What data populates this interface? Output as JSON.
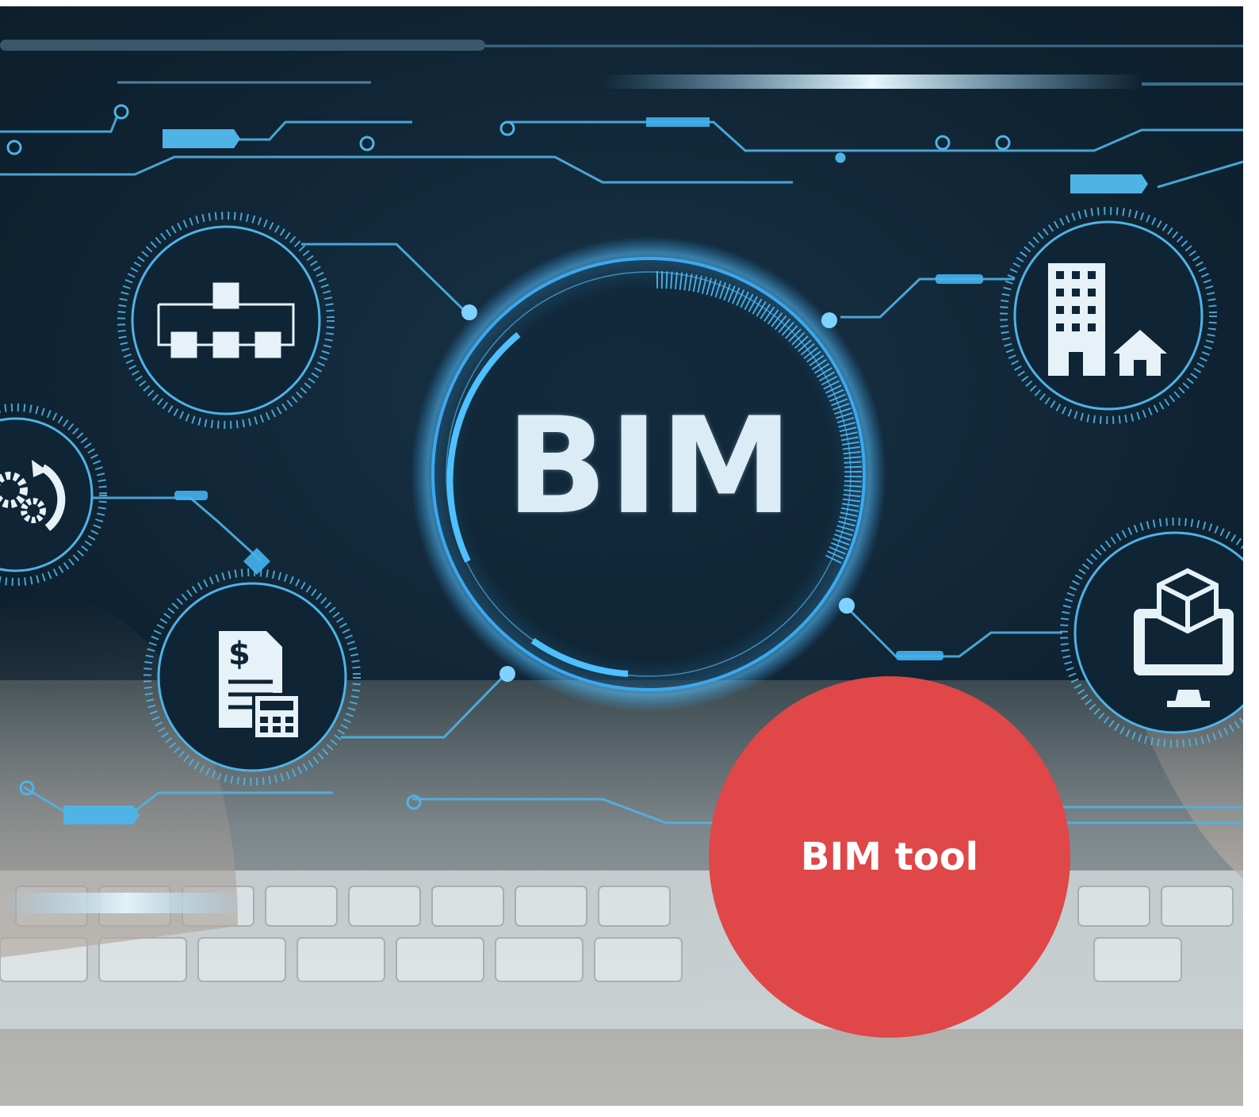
{
  "hero": {
    "center_label": "BIM",
    "icons": [
      "workflow-diagram-icon",
      "buildings-house-icon",
      "gears-cycle-icon",
      "cost-invoice-calculator-icon",
      "3d-model-monitor-icon"
    ],
    "colors": {
      "glow": "#3aa8f0",
      "line": "#4fb3e6",
      "icon_fill": "#e6f1f8",
      "background": "#0f2231"
    }
  },
  "badge": {
    "label": "BIM tool",
    "color": "#df4748"
  }
}
